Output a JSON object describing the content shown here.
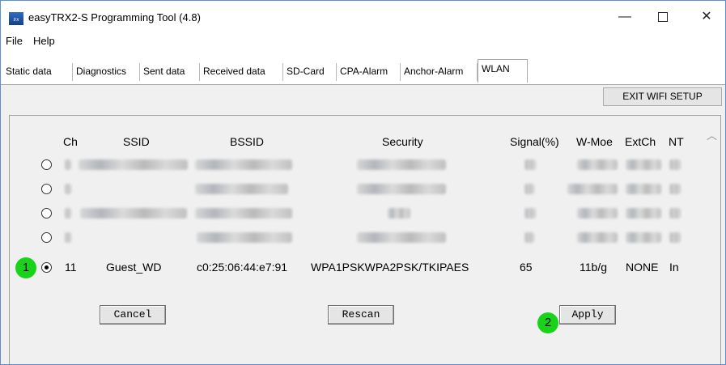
{
  "window": {
    "title": "easyTRX2-S Programming Tool  (4.8)",
    "icon_text": "trx",
    "minimize": "—",
    "close": "✕"
  },
  "menu": [
    "File",
    "Help"
  ],
  "tabs": [
    "Static data",
    "Diagnostics",
    "Sent data",
    "Received data",
    "SD-Card",
    "CPA-Alarm",
    "Anchor-Alarm",
    "WLAN"
  ],
  "active_tab": "WLAN",
  "exit_button": "EXIT WIFI SETUP",
  "scroll_up_glyph": "︿",
  "table": {
    "headers": {
      "ch": "Ch",
      "ssid": "SSID",
      "bssid": "BSSID",
      "security": "Security",
      "signal": "Signal(%)",
      "wmode": "W-Moe",
      "extch": "ExtCh",
      "nt": "NT"
    },
    "selected_row": {
      "ch": "11",
      "ssid": "Guest_WD",
      "bssid": "c0:25:06:44:e7:91",
      "security": "WPA1PSKWPA2PSK/TKIPAES",
      "signal": "65",
      "wmode": "11b/g",
      "extch": "NONE",
      "nt": "In"
    }
  },
  "buttons": {
    "cancel": "Cancel",
    "rescan": "Rescan",
    "apply": "Apply"
  },
  "badges": {
    "one": "1",
    "two": "2"
  }
}
